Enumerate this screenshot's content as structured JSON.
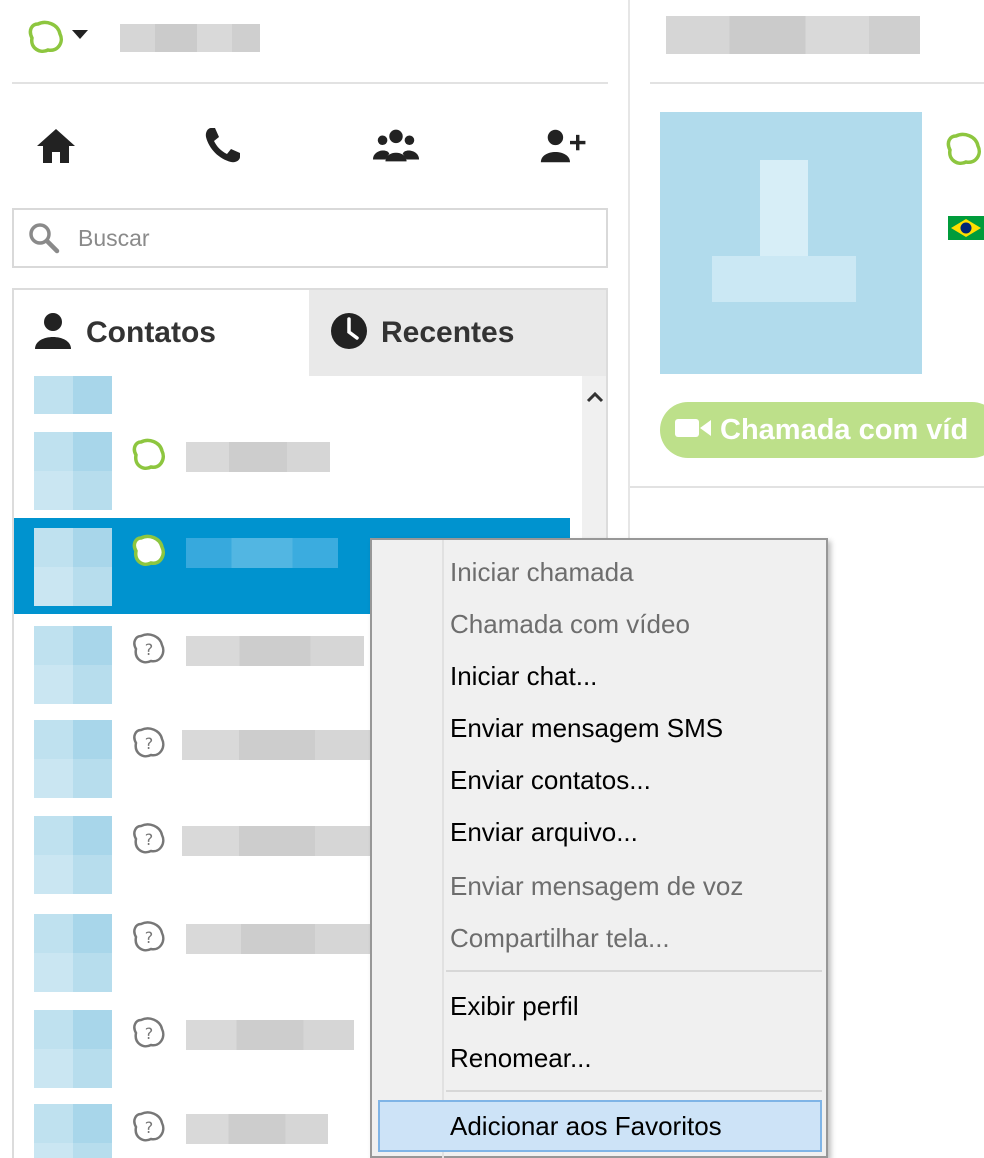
{
  "search": {
    "placeholder": "Buscar"
  },
  "tabs": [
    {
      "label": "Contatos",
      "icon": "person-icon",
      "active": true
    },
    {
      "label": "Recentes",
      "icon": "clock-icon",
      "active": false
    }
  ],
  "nav": [
    {
      "icon": "home-icon"
    },
    {
      "icon": "phone-icon"
    },
    {
      "icon": "group-icon"
    },
    {
      "icon": "add-contact-icon"
    }
  ],
  "contacts": [
    {
      "status": "partial",
      "selected": false
    },
    {
      "status": "online",
      "selected": false
    },
    {
      "status": "online",
      "selected": true
    },
    {
      "status": "unknown",
      "selected": false
    },
    {
      "status": "unknown",
      "selected": false
    },
    {
      "status": "unknown",
      "selected": false
    },
    {
      "status": "unknown",
      "selected": false
    },
    {
      "status": "unknown",
      "selected": false
    },
    {
      "status": "unknown",
      "selected": false
    }
  ],
  "profile": {
    "video_button_label": "Chamada com víd"
  },
  "context_menu": {
    "items": [
      {
        "label": "Iniciar chamada",
        "enabled": false
      },
      {
        "label": "Chamada com vídeo",
        "enabled": false
      },
      {
        "label": "Iniciar chat...",
        "enabled": true
      },
      {
        "label": "Enviar mensagem SMS",
        "enabled": true
      },
      {
        "label": "Enviar contatos...",
        "enabled": true
      },
      {
        "label": "Enviar arquivo...",
        "enabled": true
      },
      {
        "label": "Enviar mensagem de voz",
        "enabled": false
      },
      {
        "label": "Compartilhar tela...",
        "enabled": false
      },
      {
        "label": "Exibir perfil",
        "enabled": true
      },
      {
        "label": "Renomear...",
        "enabled": true
      },
      {
        "label": "Adicionar aos Favoritos",
        "enabled": true,
        "highlighted": true
      }
    ]
  },
  "colors": {
    "accent": "#0093cf",
    "skype_green": "#8dc63f",
    "menu_highlight": "#cde3f7",
    "video_button": "#bde08a"
  }
}
